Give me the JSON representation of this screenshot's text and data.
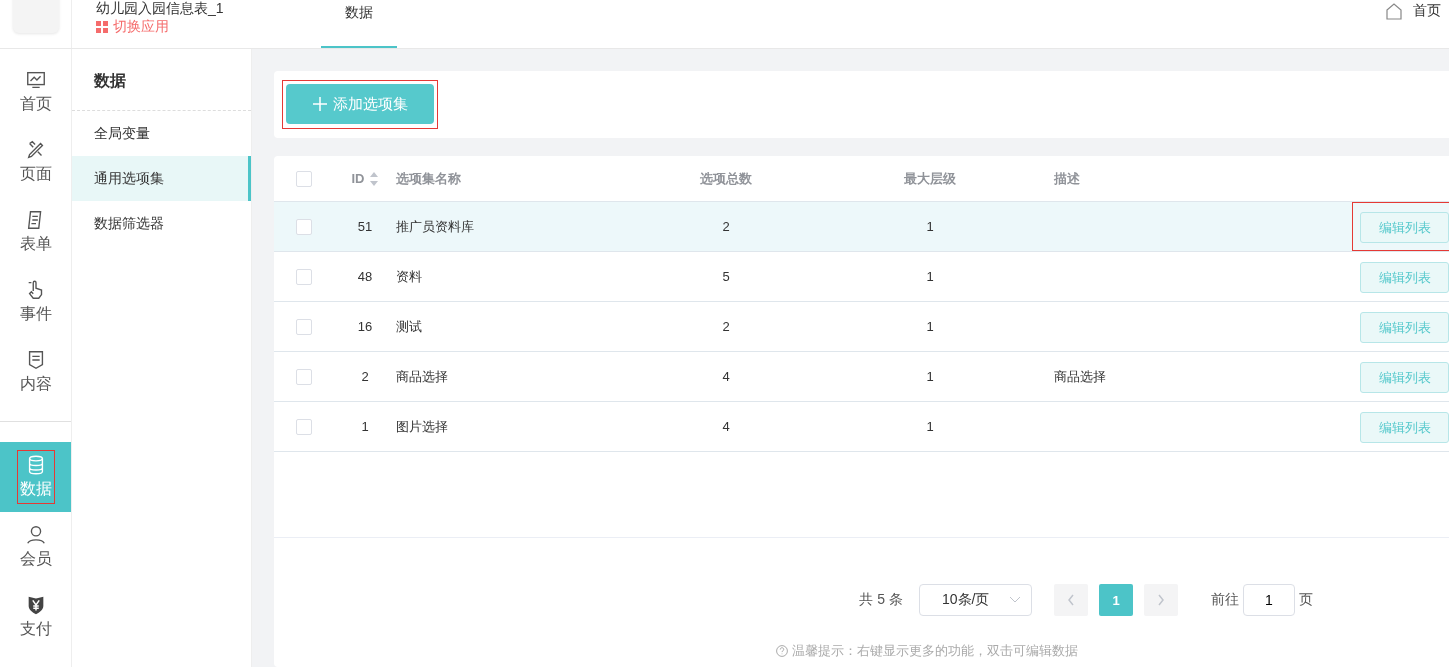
{
  "header": {
    "app_title": "幼儿园入园信息表_1",
    "switch_app": "切换应用",
    "tabs": [
      {
        "label": "数据",
        "selected": true
      }
    ],
    "home_link": "首页"
  },
  "nav": [
    {
      "label": "首页",
      "selected": false,
      "highlighted": false
    },
    {
      "label": "页面",
      "selected": false,
      "highlighted": false
    },
    {
      "label": "表单",
      "selected": false,
      "highlighted": false
    },
    {
      "label": "事件",
      "selected": false,
      "highlighted": false
    },
    {
      "label": "内容",
      "selected": false,
      "highlighted": false
    },
    {
      "label": "数据",
      "selected": true,
      "highlighted": true
    },
    {
      "label": "会员",
      "selected": false,
      "highlighted": false
    },
    {
      "label": "支付",
      "selected": false,
      "highlighted": false
    }
  ],
  "subnav": {
    "title": "数据",
    "items": [
      {
        "label": "全局变量",
        "selected": false
      },
      {
        "label": "通用选项集",
        "selected": true
      },
      {
        "label": "数据筛选器",
        "selected": false
      }
    ]
  },
  "toolbar": {
    "add_button": "添加选项集",
    "highlighted": true
  },
  "table": {
    "all_checked": false,
    "columns": [
      "ID",
      "选项集名称",
      "选项总数",
      "最大层级",
      "描述"
    ],
    "rows": [
      {
        "id": "51",
        "name": "推广员资料库",
        "count": "2",
        "level": "1",
        "desc": "",
        "checked": false,
        "hovered": true,
        "action": "编辑列表",
        "highlighted": true
      },
      {
        "id": "48",
        "name": "资料",
        "count": "5",
        "level": "1",
        "desc": "",
        "checked": false,
        "hovered": false,
        "action": "编辑列表",
        "highlighted": false
      },
      {
        "id": "16",
        "name": "测试",
        "count": "2",
        "level": "1",
        "desc": "",
        "checked": false,
        "hovered": false,
        "action": "编辑列表",
        "highlighted": false
      },
      {
        "id": "2",
        "name": "商品选择",
        "count": "4",
        "level": "1",
        "desc": "商品选择",
        "checked": false,
        "hovered": false,
        "action": "编辑列表",
        "highlighted": false
      },
      {
        "id": "1",
        "name": "图片选择",
        "count": "4",
        "level": "1",
        "desc": "",
        "checked": false,
        "hovered": false,
        "action": "编辑列表",
        "highlighted": false
      }
    ]
  },
  "pagination": {
    "total": "共 5 条",
    "page_size": "10条/页",
    "pages": [
      {
        "label": "1",
        "selected": true
      }
    ],
    "goto_label": "前往",
    "goto_value": "1",
    "goto_suffix": "页"
  },
  "hint": "温馨提示：右键显示更多的功能，双击可编辑数据"
}
